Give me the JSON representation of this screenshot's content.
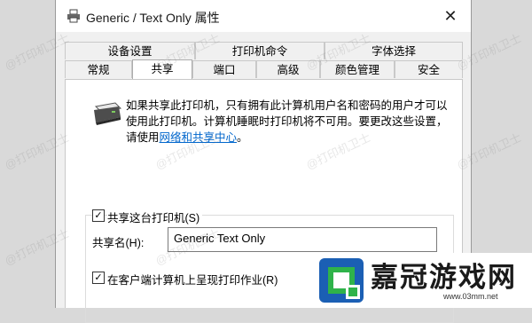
{
  "window": {
    "title": "Generic / Text Only 属性",
    "close_glyph": "✕"
  },
  "tabs_row1": [
    "设备设置",
    "打印机命令",
    "字体选择"
  ],
  "tabs_row2": [
    "常规",
    "共享",
    "端口",
    "高级",
    "颜色管理",
    "安全"
  ],
  "active_tab": "共享",
  "sharing": {
    "info_text": "如果共享此打印机，只有拥有此计算机用户名和密码的用户才可以使用此打印机。计算机睡眠时打印机将不可用。要更改这些设置，请使用",
    "info_link": "网络和共享中心",
    "info_end": "。",
    "share_checkbox_label": "共享这台打印机(S)",
    "share_checked": true,
    "share_name_label": "共享名(H):",
    "share_name_value": "Generic  Text Only",
    "render_checkbox_label": "在客户端计算机上呈现打印作业(R)",
    "render_checked": true
  },
  "watermark": "@打印机卫士",
  "brand": {
    "name": "嘉冠游戏网",
    "url": "www.03mm.net"
  },
  "colors": {
    "link": "#0066cc",
    "logo_green": "#2fb34a",
    "logo_blue": "#1b5fb4"
  },
  "icons": {
    "title": "printer-icon",
    "close": "close-icon",
    "panel": "printer-icon"
  }
}
